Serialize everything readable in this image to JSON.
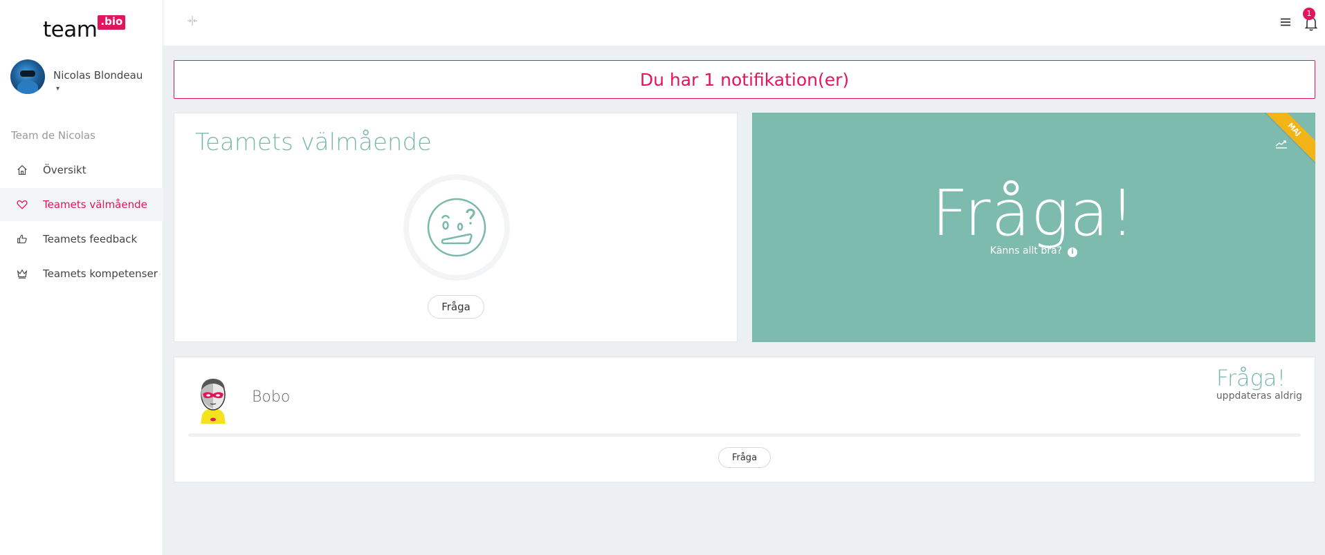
{
  "brand": {
    "name": "team",
    "badge": ".bio",
    "accent": "#e2145c",
    "teal": "#7dbbae"
  },
  "user": {
    "name": "Nicolas Blondeau",
    "caret": "▾"
  },
  "sidebar": {
    "team_label": "Team de Nicolas",
    "items": [
      {
        "label": "Översikt",
        "icon": "home-icon",
        "active": false
      },
      {
        "label": "Teamets välmående",
        "icon": "heart-icon",
        "active": true
      },
      {
        "label": "Teamets feedback",
        "icon": "thumbs-up-icon",
        "active": false
      },
      {
        "label": "Teamets kompetenser",
        "icon": "crown-icon",
        "active": false
      }
    ]
  },
  "topbar": {
    "notification_count": "1"
  },
  "notification": {
    "text": "Du har 1 notifikation(er)"
  },
  "wellbeing": {
    "title": "Teamets välmående",
    "ask_button": "Fråga"
  },
  "highlight": {
    "headline": "Fråga!",
    "subtitle": "Känns allt bra?",
    "ribbon": "MAJ"
  },
  "member": {
    "name": "Bobo",
    "status": "Fråga!",
    "updated": "uppdateras aldrig",
    "ask_button": "Fråga"
  }
}
